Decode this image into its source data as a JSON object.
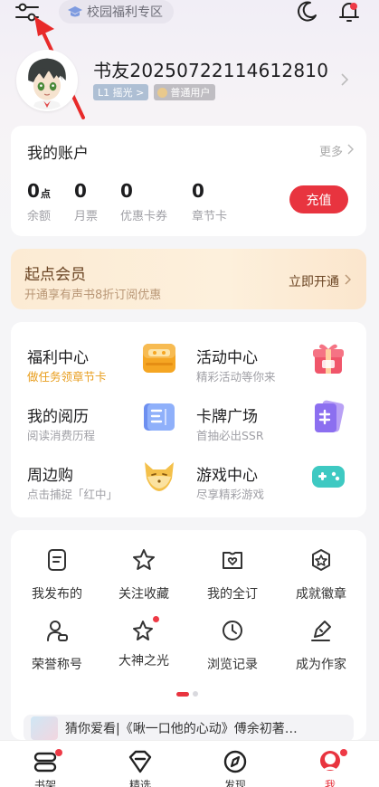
{
  "topbar": {
    "campus_label": "校园福利专区",
    "icons": [
      "filter-settings-icon",
      "graduation-cap-icon",
      "moon-icon",
      "bell-icon"
    ]
  },
  "profile": {
    "username": "书友20250722114612810",
    "level_badge": "L1 摇光 >",
    "user_badge": "普通用户"
  },
  "account": {
    "title": "我的账户",
    "more_label": "更多",
    "stats": [
      {
        "value": "0",
        "unit": "点",
        "label": "余额"
      },
      {
        "value": "0",
        "unit": "",
        "label": "月票"
      },
      {
        "value": "0",
        "unit": "",
        "label": "优惠卡券"
      },
      {
        "value": "0",
        "unit": "",
        "label": "章节卡"
      }
    ],
    "recharge_label": "充值"
  },
  "vip": {
    "title": "起点会员",
    "subtitle": "开通享有声书8折订阅优惠",
    "button": "立即开通"
  },
  "services": [
    {
      "title": "福利中心",
      "subtitle": "做任务领章节卡",
      "icon": "gift-box-icon"
    },
    {
      "title": "活动中心",
      "subtitle": "精彩活动等你来",
      "icon": "present-icon"
    },
    {
      "title": "我的阅历",
      "subtitle": "阅读消费历程",
      "icon": "open-book-icon"
    },
    {
      "title": "卡牌广场",
      "subtitle": "首抽必出SSR",
      "icon": "card-icon"
    },
    {
      "title": "周边购",
      "subtitle": "点击捕捉「红中」",
      "icon": "fox-icon"
    },
    {
      "title": "游戏中心",
      "subtitle": "尽享精彩游戏",
      "icon": "gamepad-icon"
    }
  ],
  "tools": [
    {
      "label": "我发布的",
      "icon": "document-icon"
    },
    {
      "label": "关注收藏",
      "icon": "star-icon"
    },
    {
      "label": "我的全订",
      "icon": "heart-ticket-icon"
    },
    {
      "label": "成就徽章",
      "icon": "badge-star-icon"
    },
    {
      "label": "荣誉称号",
      "icon": "person-title-icon"
    },
    {
      "label": "大神之光",
      "icon": "sparkle-star-icon"
    },
    {
      "label": "浏览记录",
      "icon": "clock-icon"
    },
    {
      "label": "成为作家",
      "icon": "pen-icon"
    }
  ],
  "guess": {
    "text": "猜你爱看|《啾一口他的心动》傅余初著…"
  },
  "tabbar": {
    "tabs": [
      {
        "label": "书架",
        "icon": "bookshelf-icon"
      },
      {
        "label": "精选",
        "icon": "diamond-icon"
      },
      {
        "label": "发现",
        "icon": "compass-icon"
      },
      {
        "label": "我",
        "icon": "me-avatar-icon"
      }
    ]
  },
  "colors": {
    "accent": "#e8343f",
    "vip_text": "#6b4524",
    "orange_subtitle": "#e89d1c"
  }
}
